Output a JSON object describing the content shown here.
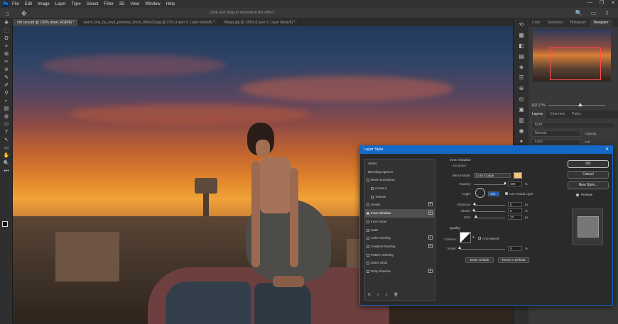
{
  "menubar": {
    "logo": "Ps",
    "items": [
      "File",
      "Edit",
      "Image",
      "Layer",
      "Type",
      "Select",
      "Filter",
      "3D",
      "View",
      "Window",
      "Help"
    ],
    "controls": [
      "—",
      "❐",
      "✕"
    ]
  },
  "options_bar": {
    "home_icon": "⌂",
    "move_icon": "✥",
    "hint": "Click and drag to reposition the effect.",
    "right_icons": [
      "🔍",
      "▭",
      "⇪"
    ]
  },
  "tabs": [
    {
      "label": "old car.psd @ 102% (man, RGB/8) *",
      "active": true
    },
    {
      "label": "watch_boy_by_esys_pawmas_stock_d0xfa32.jpg @ 21% (Layer 0, Layer Mask/8) *",
      "active": false
    },
    {
      "label": "Wings.jpg @ 133% (Layer 0, Layer Mask/8) *",
      "active": false
    }
  ],
  "toolbar": {
    "tools": [
      "✥",
      "⬚",
      "ʘ",
      "⌖",
      "⊞",
      "✂",
      "⊘",
      "✎",
      "✐",
      "⚲",
      "◐",
      "▤",
      "◍",
      "⬭",
      "T",
      "↖",
      "▭",
      "✋",
      "🔍",
      "•••"
    ]
  },
  "dock": {
    "icons": [
      "⟲",
      "▦",
      "◧",
      "▤",
      "◈",
      "☰",
      "⊕",
      "◎",
      "▣",
      "▥",
      "◉",
      "✦",
      "A",
      "¶"
    ]
  },
  "panels": {
    "top_tabs": [
      {
        "label": "Color",
        "active": false
      },
      {
        "label": "Swatches",
        "active": false
      },
      {
        "label": "Histogram",
        "active": false
      },
      {
        "label": "Navigator",
        "active": true
      }
    ],
    "nav_zoom": "102.27%",
    "layers_tabs": [
      {
        "label": "Layers",
        "active": true
      },
      {
        "label": "Channels",
        "active": false
      },
      {
        "label": "Paths",
        "active": false
      }
    ],
    "layer_rows": [
      "Kind",
      "Normal",
      "Lock:"
    ],
    "opacity_label": "Opacity:",
    "fill_label": "Fill:"
  },
  "dialog": {
    "title": "Layer Style",
    "close_icon": "✕",
    "styles": [
      {
        "label": "Styles",
        "type": "header"
      },
      {
        "label": "Blending Options",
        "type": "header"
      },
      {
        "label": "Bevel & Emboss",
        "type": "check",
        "checked": false
      },
      {
        "label": "Contour",
        "type": "sub",
        "checked": false
      },
      {
        "label": "Texture",
        "type": "sub",
        "checked": false
      },
      {
        "label": "Stroke",
        "type": "check",
        "checked": false,
        "plus": true
      },
      {
        "label": "Inner Shadow",
        "type": "check",
        "checked": true,
        "plus": true,
        "selected": true
      },
      {
        "label": "Inner Glow",
        "type": "check",
        "checked": false
      },
      {
        "label": "Satin",
        "type": "check",
        "checked": false
      },
      {
        "label": "Color Overlay",
        "type": "check",
        "checked": false,
        "plus": true
      },
      {
        "label": "Gradient Overlay",
        "type": "check",
        "checked": false,
        "plus": true
      },
      {
        "label": "Pattern Overlay",
        "type": "check",
        "checked": false
      },
      {
        "label": "Outer Glow",
        "type": "check",
        "checked": false
      },
      {
        "label": "Drop Shadow",
        "type": "check",
        "checked": false,
        "plus": true
      }
    ],
    "list_footer": [
      "fx",
      "⇧",
      "⇩",
      "🗑"
    ],
    "inner_shadow": {
      "section": "Inner Shadow",
      "subsection": "Structure",
      "blend_mode_label": "Blend Mode:",
      "blend_mode": "Color Dodge",
      "shadow_color": "#f5c27a",
      "opacity_label": "Opacity:",
      "opacity": "100",
      "opacity_level": 1.0,
      "angle_label": "Angle:",
      "angle": "104",
      "global_light_label": "Use Global Light",
      "global_light_checked": true,
      "distance_label": "Distance:",
      "distance": "5",
      "distance_level": 0.04,
      "choke_label": "Choke:",
      "choke": "0",
      "choke_level": 0.0,
      "size_label": "Size:",
      "size": "10",
      "size_level": 0.08,
      "px": "px",
      "percent": "%",
      "quality_title": "Quality",
      "contour_label": "Contour:",
      "antialiased_label": "Anti-aliased",
      "noise_label": "Noise:",
      "noise": "0",
      "noise_level": 0.0,
      "make_default": "Make Default",
      "reset_default": "Reset to Default"
    },
    "buttons": {
      "ok": "OK",
      "cancel": "Cancel",
      "new_style": "New Style...",
      "preview_label": "Preview",
      "preview_checked": true
    }
  }
}
